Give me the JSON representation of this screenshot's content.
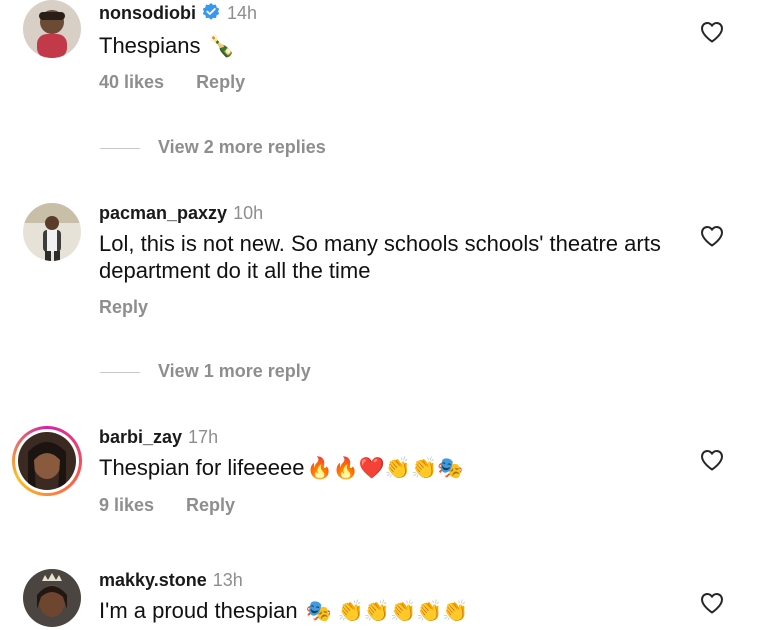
{
  "comments": [
    {
      "username": "nonsodiobi",
      "verified": true,
      "time": "14h",
      "text": "Thespians",
      "emoji": "🍾",
      "likes": "40 likes",
      "reply": "Reply",
      "view_more": "View 2 more replies"
    },
    {
      "username": "pacman_paxzy",
      "verified": false,
      "time": "10h",
      "text": "Lol, this is not new. So many schools schools' theatre arts department do it all the time",
      "emoji": "",
      "likes": "",
      "reply": "Reply",
      "view_more": "View 1 more reply"
    },
    {
      "username": "barbi_zay",
      "verified": false,
      "time": "17h",
      "text": "Thespian for lifeeeee",
      "emoji": "🔥🔥❤️👏👏🎭",
      "likes": "9 likes",
      "reply": "Reply",
      "has_story_ring": true
    },
    {
      "username": "makky.stone",
      "verified": false,
      "time": "13h",
      "text": "I'm a proud thespian",
      "emoji": "🎭 👏👏👏👏👏",
      "likes": "",
      "reply": ""
    }
  ],
  "icons": {
    "heart": "heart-outline-icon",
    "verified": "verified-badge-icon"
  },
  "colors": {
    "verified_blue": "#3897f0",
    "muted_text": "#8e8e8e",
    "story_ring": "#d6249f"
  }
}
